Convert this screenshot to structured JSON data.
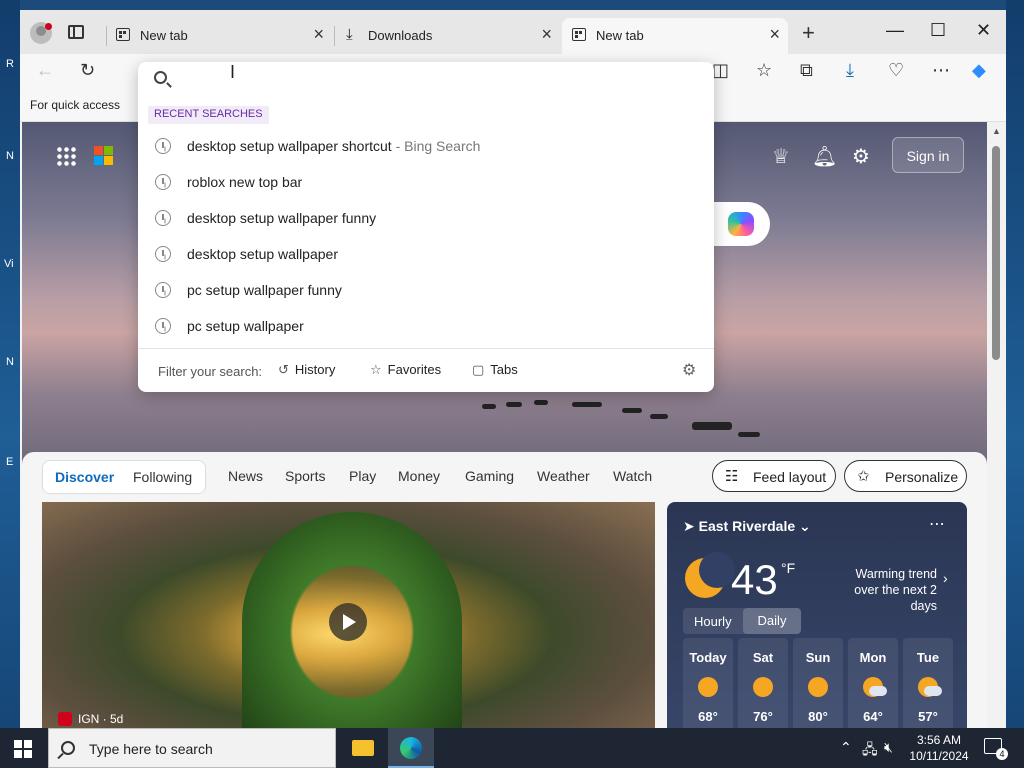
{
  "browser": {
    "tabs": [
      {
        "label": "New tab",
        "icon": "newtab-icon"
      },
      {
        "label": "Downloads",
        "icon": "download-icon"
      },
      {
        "label": "New tab",
        "icon": "newtab-icon"
      }
    ],
    "favorites_bar_text": "For quick access"
  },
  "search_dropdown": {
    "input_value": "",
    "section_label": "RECENT SEARCHES",
    "items": [
      {
        "text": "desktop setup wallpaper shortcut",
        "suffix": " - Bing Search"
      },
      {
        "text": "roblox new top bar",
        "suffix": ""
      },
      {
        "text": "desktop setup wallpaper funny",
        "suffix": ""
      },
      {
        "text": "desktop setup wallpaper",
        "suffix": ""
      },
      {
        "text": "pc setup wallpaper funny",
        "suffix": ""
      },
      {
        "text": "pc setup wallpaper",
        "suffix": ""
      }
    ],
    "filter_label": "Filter your search:",
    "filters": [
      "History",
      "Favorites",
      "Tabs"
    ]
  },
  "newtab_page": {
    "signin_label": "Sign in",
    "hero_fragment": "cut",
    "pivots": [
      "Discover",
      "Following"
    ],
    "nav_links": [
      "News",
      "Sports",
      "Play",
      "Money",
      "Gaming",
      "Weather",
      "Watch"
    ],
    "feed_layout_label": "Feed layout",
    "personalize_label": "Personalize",
    "video_source": "IGN · 5d",
    "weather": {
      "location": "East Riverdale",
      "temp": "43",
      "unit": "°F",
      "trend_line1": "Warming trend",
      "trend_line2": "over the next 2 days",
      "tabs": [
        "Hourly",
        "Daily"
      ],
      "days": [
        {
          "name": "Today",
          "temp": "68°",
          "icon": "sunny-icon"
        },
        {
          "name": "Sat",
          "temp": "76°",
          "icon": "sunny-icon"
        },
        {
          "name": "Sun",
          "temp": "80°",
          "icon": "sunny-icon"
        },
        {
          "name": "Mon",
          "temp": "64°",
          "icon": "partly-cloudy-icon"
        },
        {
          "name": "Tue",
          "temp": "57°",
          "icon": "partly-cloudy-icon"
        }
      ]
    }
  },
  "taskbar": {
    "search_placeholder": "Type here to search",
    "time": "3:56 AM",
    "date": "10/11/2024",
    "notification_count": "4"
  },
  "desktop": {
    "letters": [
      "R",
      "N",
      "Vi",
      "N",
      "E"
    ]
  },
  "colors": {
    "accent": "#0f6cbd",
    "recent_label": "#6b2aa5"
  }
}
